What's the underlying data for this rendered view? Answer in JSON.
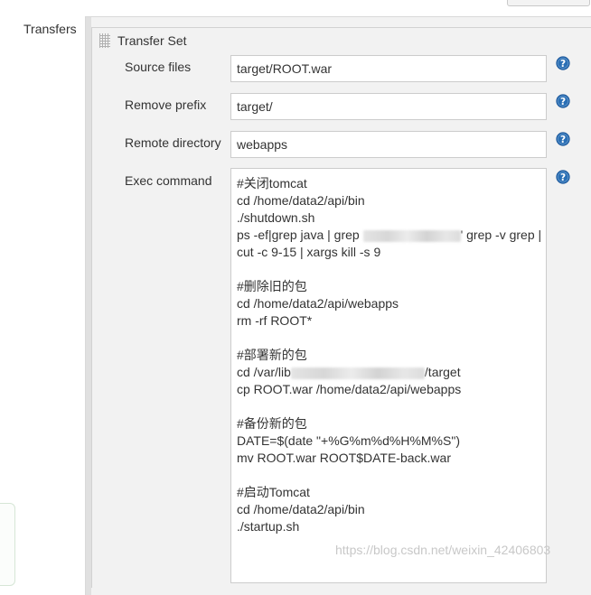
{
  "sidebar": {
    "label": "Transfers"
  },
  "transfer_set": {
    "title": "Transfer Set",
    "fields": {
      "source_files": {
        "label": "Source files",
        "value": "target/ROOT.war"
      },
      "remove_prefix": {
        "label": "Remove prefix",
        "value": "target/"
      },
      "remote_directory": {
        "label": "Remote directory",
        "value": "webapps"
      },
      "exec_command": {
        "label": "Exec command",
        "lines": [
          "#关闭tomcat",
          "cd /home/data2/api/bin",
          "./shutdown.sh",
          "ps -ef|grep java | grep",
          "' grep -v grep |",
          "cut -c 9-15 | xargs kill -s 9",
          "",
          "#删除旧的包",
          "cd /home/data2/api/webapps",
          "rm -rf ROOT*",
          "",
          "#部署新的包",
          "cd /var/lib",
          "/target",
          "cp ROOT.war /home/data2/api/webapps",
          "",
          "#备份新的包",
          "DATE=$(date \"+%G%m%d%H%M%S\")",
          "mv ROOT.war ROOT$DATE-back.war",
          "",
          "#启动Tomcat",
          "cd /home/data2/api/bin",
          "./startup.sh"
        ]
      }
    },
    "help_icon": "help-question-icon"
  },
  "watermark": "https://blog.csdn.net/weixin_42406803",
  "colors": {
    "help_icon": "#2a6fb5",
    "panel_bg": "#f2f2f2",
    "input_border": "#cccccc"
  }
}
